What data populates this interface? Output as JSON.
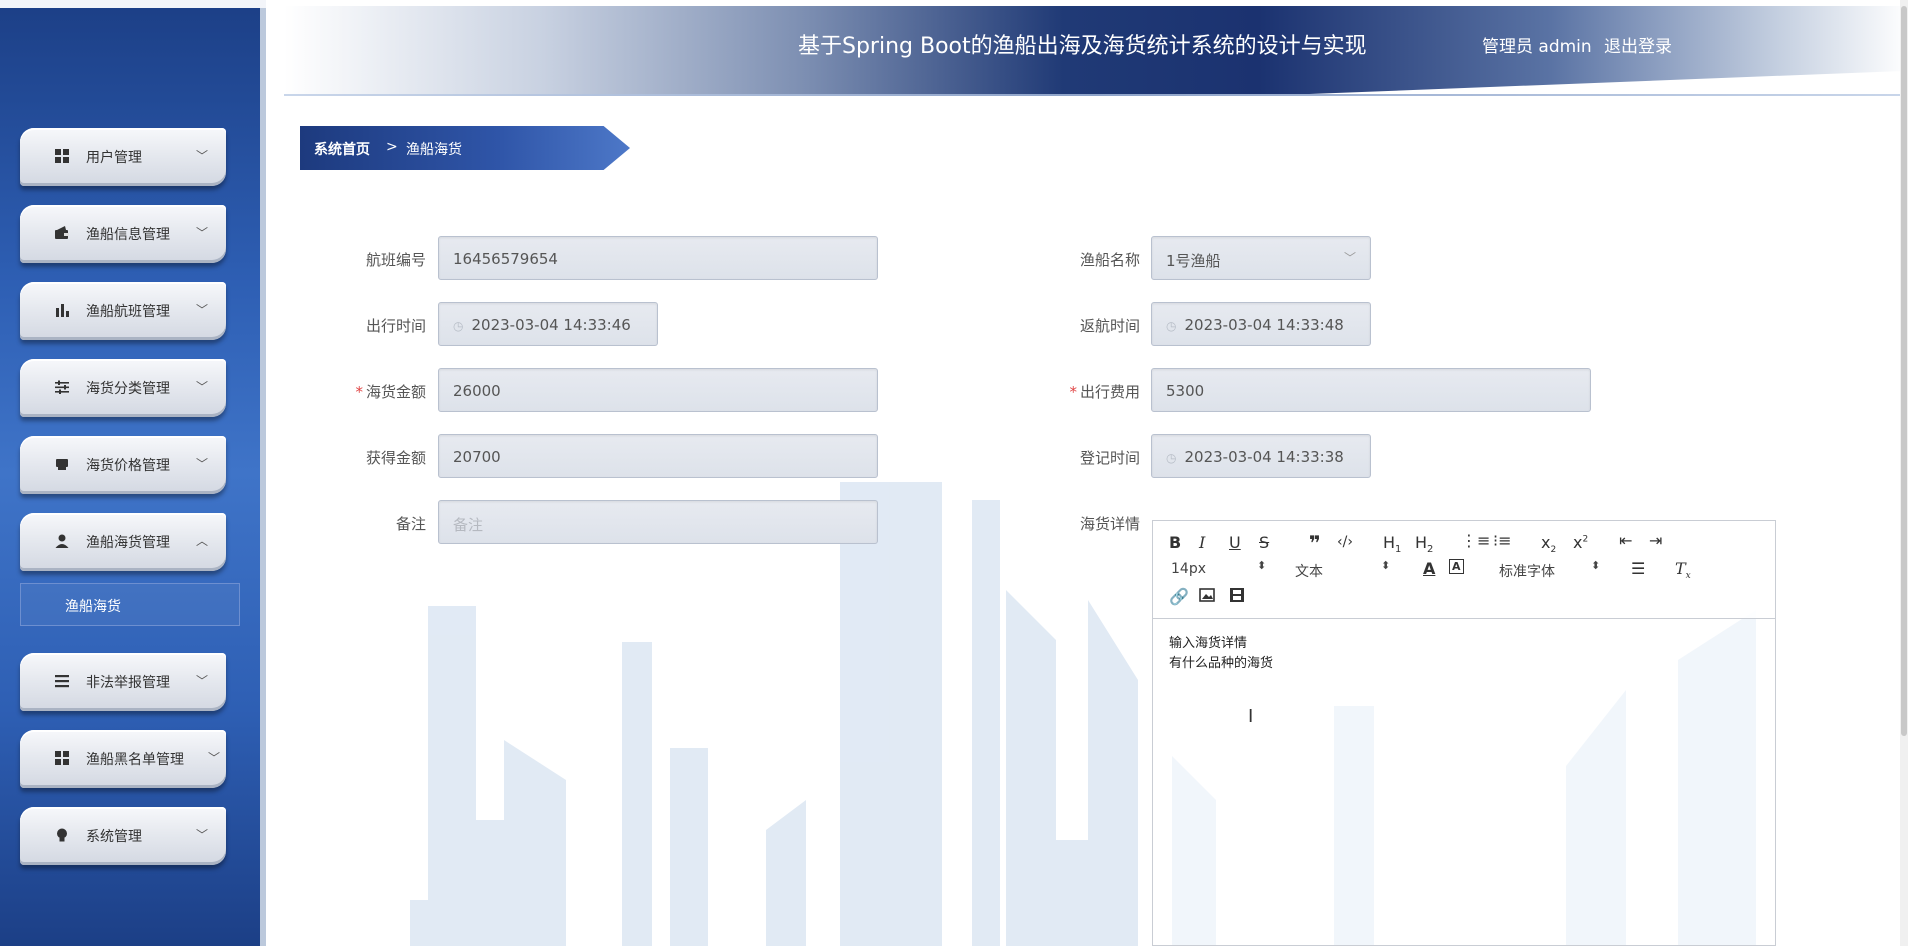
{
  "header": {
    "title": "基于Spring Boot的渔船出海及海货统计系统的设计与实现",
    "user_label": "管理员 admin",
    "logout_label": "退出登录"
  },
  "sidebar": {
    "items": [
      {
        "label": "用户管理",
        "icon": "grid-icon",
        "expanded": false
      },
      {
        "label": "渔船信息管理",
        "icon": "wallet-icon",
        "expanded": false
      },
      {
        "label": "渔船航班管理",
        "icon": "bar-chart-icon",
        "expanded": false
      },
      {
        "label": "海货分类管理",
        "icon": "sliders-icon",
        "expanded": false
      },
      {
        "label": "海货价格管理",
        "icon": "tag-icon",
        "expanded": false
      },
      {
        "label": "渔船海货管理",
        "icon": "user-icon",
        "expanded": true
      },
      {
        "label": "非法举报管理",
        "icon": "list-icon",
        "expanded": false
      },
      {
        "label": "渔船黑名单管理",
        "icon": "grid-icon",
        "expanded": false
      },
      {
        "label": "系统管理",
        "icon": "bulb-icon",
        "expanded": false
      }
    ],
    "submenu": {
      "label": "渔船海货"
    }
  },
  "breadcrumb": {
    "home": "系统首页",
    "separator": ">",
    "current": "渔船海货"
  },
  "form": {
    "flight_no": {
      "label": "航班编号",
      "value": "16456579654"
    },
    "ship_name": {
      "label": "渔船名称",
      "value": "1号渔船"
    },
    "depart_time": {
      "label": "出行时间",
      "value": "2023-03-04 14:33:46"
    },
    "return_time": {
      "label": "返航时间",
      "value": "2023-03-04 14:33:48"
    },
    "goods_amount": {
      "label": "海货金额",
      "value": "26000",
      "required": "*"
    },
    "trip_cost": {
      "label": "出行费用",
      "value": "5300",
      "required": "*"
    },
    "profit": {
      "label": "获得金额",
      "value": "20700"
    },
    "register_time": {
      "label": "登记时间",
      "value": "2023-03-04 14:33:38"
    },
    "remark": {
      "label": "备注",
      "placeholder": "备注"
    },
    "details": {
      "label": "海货详情"
    }
  },
  "editor": {
    "font_size": "14px",
    "block_type": "文本",
    "font_family": "标准字体",
    "content_line1": "输入海货详情",
    "content_line2": "有什么品种的海货"
  }
}
